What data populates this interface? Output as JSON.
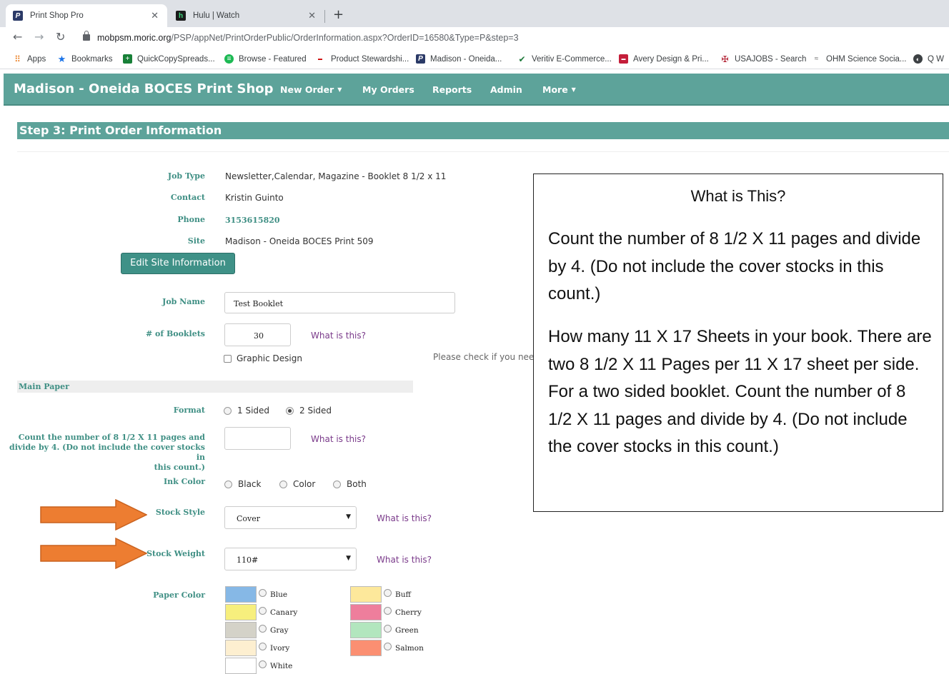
{
  "browser": {
    "tabs": [
      {
        "title": "Print Shop Pro",
        "icon": "P"
      },
      {
        "title": "Hulu | Watch",
        "icon": "h"
      }
    ],
    "url_host": "mobpsm.moric.org",
    "url_path": "/PSP/appNet/PrintOrderPublic/OrderInformation.aspx?OrderID=16580&Type=P&step=3",
    "bookmarks": [
      "Apps",
      "Bookmarks",
      "QuickCopySpreads...",
      "Browse - Featured",
      "Product Stewardshi...",
      "Madison - Oneida...",
      "Veritiv E-Commerce...",
      "Avery Design & Pri...",
      "USAJOBS - Search",
      "OHM Science Socia...",
      "Q W"
    ]
  },
  "nav": {
    "brand": "Madison - Oneida BOCES Print Shop",
    "links": [
      "New Order",
      "My Orders",
      "Reports",
      "Admin",
      "More"
    ]
  },
  "step_title": "Step 3: Print Order Information",
  "info": {
    "job_type_label": "Job Type",
    "job_type": "Newsletter,Calendar, Magazine - Booklet 8 1/2 x 11",
    "contact_label": "Contact",
    "contact": "Kristin Guinto",
    "phone_label": "Phone",
    "phone": "3153615820",
    "site_label": "Site",
    "site": "Madison - Oneida BOCES Print 509",
    "edit_button": "Edit Site Information"
  },
  "form": {
    "job_name_label": "Job Name",
    "job_name": "Test Booklet",
    "booklets_label": "# of Booklets",
    "booklets": "30",
    "what_is_this": "What is this?",
    "graphic_design": "Graphic Design",
    "graphic_note": "Please check if you need",
    "main_paper": "Main Paper",
    "format_label": "Format",
    "format_options": [
      "1 Sided",
      "2 Sided"
    ],
    "format_selected": "2 Sided",
    "count_label_lines": [
      "Count the number of 8 1/2 X 11 pages and",
      "divide by 4. (Do not include the cover stocks in",
      "this count.)"
    ],
    "ink_label": "Ink Color",
    "ink_options": [
      "Black",
      "Color",
      "Both"
    ],
    "stock_style_label": "Stock Style",
    "stock_style": "Cover",
    "stock_weight_label": "Stock Weight",
    "stock_weight": "110#",
    "paper_color_label": "Paper Color",
    "colors": [
      {
        "name": "Blue",
        "hex": "#86b8e6"
      },
      {
        "name": "Buff",
        "hex": "#fde89b"
      },
      {
        "name": "Canary",
        "hex": "#f7ef7d"
      },
      {
        "name": "Cherry",
        "hex": "#ee7e9c"
      },
      {
        "name": "Gray",
        "hex": "#d4d2c8"
      },
      {
        "name": "Green",
        "hex": "#b2e6be"
      },
      {
        "name": "Ivory",
        "hex": "#fdefd0"
      },
      {
        "name": "Salmon",
        "hex": "#fb8f72"
      },
      {
        "name": "White",
        "hex": "#ffffff"
      }
    ]
  },
  "tooltip": {
    "title": "What is This?",
    "p1": "Count the number of 8 1/2 X 11 pages and divide by 4. (Do not include the cover stocks in this count.)",
    "p2": "How many 11 X 17 Sheets in your book. There are two 8 1/2 X 11 Pages per 11 X 17 sheet per side. For a two sided booklet. Count the number of 8 1/2 X 11 pages and divide by 4. (Do not include the cover stocks in this count.)"
  },
  "colors": {
    "nav": "#5da39a",
    "label": "#3f8f84",
    "link": "#7a3a8a",
    "arrow": "#ed7d31"
  }
}
